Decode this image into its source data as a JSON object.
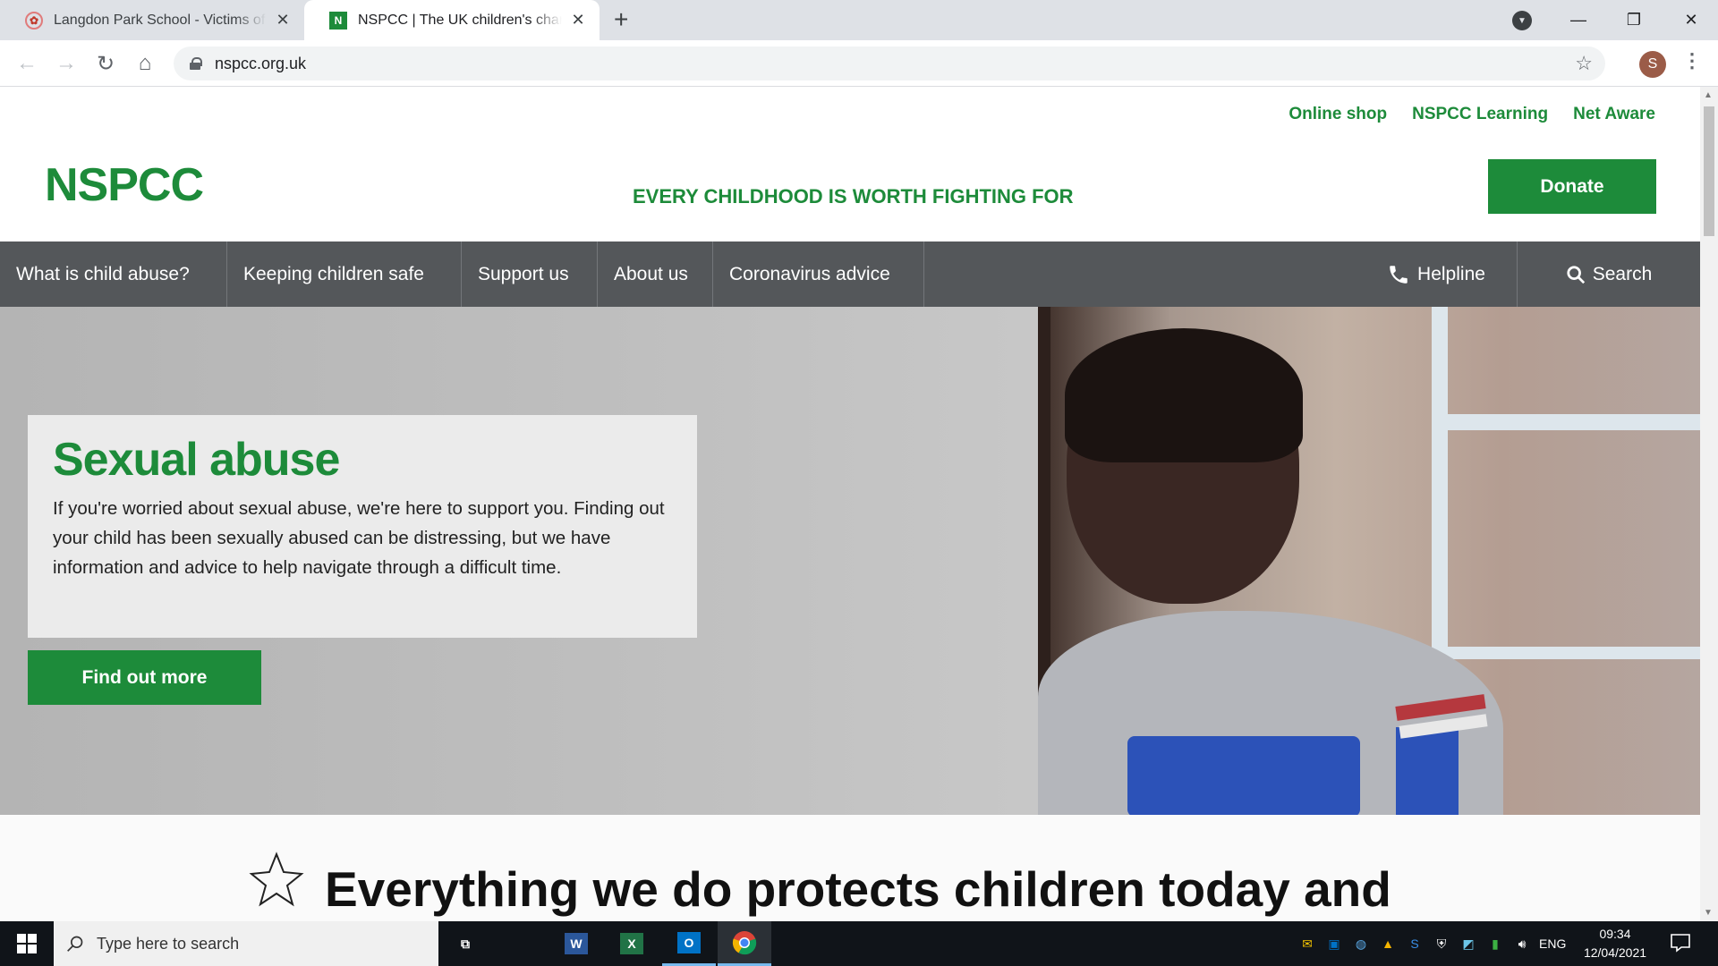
{
  "browser": {
    "tabs": [
      {
        "title": "Langdon Park School - Victims of",
        "favicon": "school-crest-icon"
      },
      {
        "title": "NSPCC | The UK children's charity",
        "favicon": "nspcc-n-icon",
        "favicon_letter": "N"
      }
    ],
    "url": "nspcc.org.uk",
    "profile_initial": "S"
  },
  "site": {
    "utility_links": [
      "Online shop",
      "NSPCC Learning",
      "Net Aware"
    ],
    "logo": "NSPCC",
    "tagline": "EVERY CHILDHOOD IS WORTH FIGHTING FOR",
    "donate_label": "Donate",
    "nav": {
      "items": [
        "What is child abuse?",
        "Keeping children safe",
        "Support us",
        "About us",
        "Coronavirus advice"
      ],
      "helpline": "Helpline",
      "search": "Search"
    },
    "hero": {
      "title": "Sexual abuse",
      "body": "If you're worried about sexual abuse, we're here to support you. Finding out your child has been sexually abused can be distressing, but we have information and advice to help navigate through a difficult time.",
      "cta": "Find out more"
    },
    "mission_heading": "Everything we do protects children today and"
  },
  "taskbar": {
    "search_placeholder": "Type here to search",
    "language": "ENG",
    "time": "09:34",
    "date": "12/04/2021"
  },
  "colors": {
    "brand_green": "#1d8b3a",
    "nav_grey": "#54575a"
  }
}
